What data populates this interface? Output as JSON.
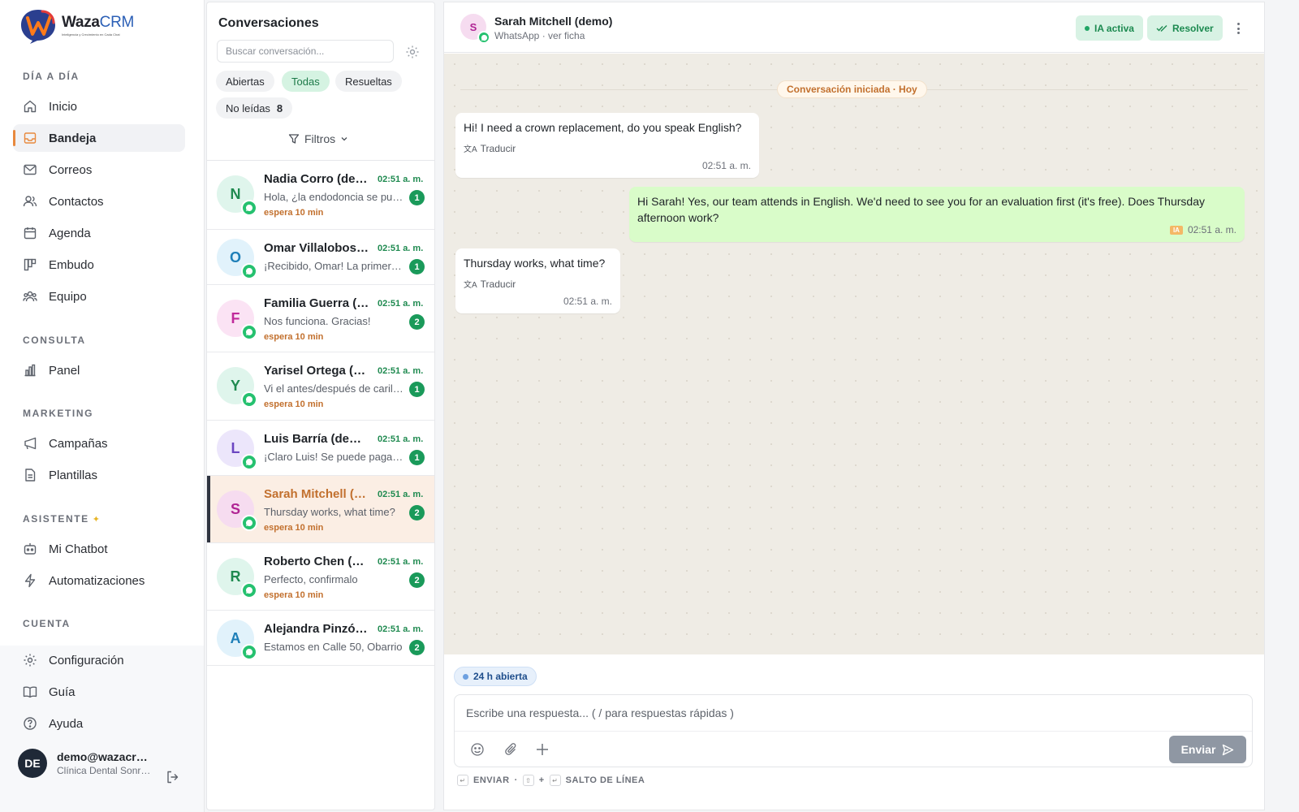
{
  "brand": {
    "name_a": "Waza",
    "name_b": "CRM",
    "tagline": "Inteligencia y Crecimiento en Cada Chat"
  },
  "sidebar": {
    "sections": [
      {
        "title": "DÍA A DÍA"
      },
      {
        "title": "CONSULTA"
      },
      {
        "title": "MARKETING"
      },
      {
        "title": "ASISTENTE"
      },
      {
        "title": "CUENTA"
      }
    ],
    "items": [
      {
        "label": "Inicio",
        "icon": "home-icon"
      },
      {
        "label": "Bandeja",
        "icon": "inbox-icon",
        "active": true
      },
      {
        "label": "Correos",
        "icon": "mail-icon"
      },
      {
        "label": "Contactos",
        "icon": "contacts-icon"
      },
      {
        "label": "Agenda",
        "icon": "calendar-icon"
      },
      {
        "label": "Embudo",
        "icon": "funnel-icon"
      },
      {
        "label": "Equipo",
        "icon": "team-icon"
      },
      {
        "label": "Panel",
        "icon": "chart-icon"
      },
      {
        "label": "Campañas",
        "icon": "campaign-icon"
      },
      {
        "label": "Plantillas",
        "icon": "template-icon"
      },
      {
        "label": "Mi Chatbot",
        "icon": "bot-icon"
      },
      {
        "label": "Automatizaciones",
        "icon": "bolt-icon"
      },
      {
        "label": "Configuración",
        "icon": "settings-icon"
      },
      {
        "label": "Guía",
        "icon": "book-icon"
      },
      {
        "label": "Ayuda",
        "icon": "help-icon"
      }
    ],
    "user": {
      "initials": "DE",
      "email": "demo@wazacrm.com",
      "org": "Clínica Dental Sonrisa"
    }
  },
  "conversations": {
    "title": "Conversaciones",
    "search_placeholder": "Buscar conversación...",
    "filters": {
      "open": "Abiertas",
      "all": "Todas",
      "resolved": "Resueltas",
      "unread": "No leídas",
      "unread_count": "8",
      "filters_label": "Filtros"
    },
    "items": [
      {
        "initial": "N",
        "name": "Nadia Corro (demo)",
        "time": "02:51 a. m.",
        "preview": "Hola, ¿la endodoncia se puede hacer en una cita?",
        "badge": "1",
        "wait": "espera 10 min",
        "bg": "#dff5ec",
        "fg": "#1f8a50"
      },
      {
        "initial": "O",
        "name": "Omar Villalobos (demo)",
        "time": "02:51 a. m.",
        "preview": "¡Recibido, Omar! La primera consulta es gratis",
        "badge": "1",
        "wait": "",
        "bg": "#e1f2fb",
        "fg": "#1e7fb8"
      },
      {
        "initial": "F",
        "name": "Familia Guerra (demo)",
        "time": "02:51 a. m.",
        "preview": "Nos funciona. Gracias!",
        "badge": "2",
        "wait": "espera 10 min",
        "bg": "#fbe3f4",
        "fg": "#c02a9b"
      },
      {
        "initial": "Y",
        "name": "Yarisel Ortega (demo)",
        "time": "02:51 a. m.",
        "preview": "Vi el antes/después de carillas en Instagram",
        "badge": "1",
        "wait": "espera 10 min",
        "bg": "#dff5ec",
        "fg": "#1f8a50"
      },
      {
        "initial": "L",
        "name": "Luis Barría (demo)",
        "time": "02:51 a. m.",
        "preview": "¡Claro Luis! Se puede pagar en cuotas",
        "badge": "1",
        "wait": "",
        "bg": "#ece6fb",
        "fg": "#6b46c1"
      },
      {
        "initial": "S",
        "name": "Sarah Mitchell (demo)",
        "time": "02:51 a. m.",
        "preview": "Thursday works, what time?",
        "badge": "2",
        "wait": "espera 10 min",
        "bg": "#f6dcf0",
        "fg": "#b02494",
        "active": true
      },
      {
        "initial": "R",
        "name": "Roberto Chen (demo)",
        "time": "02:51 a. m.",
        "preview": "Perfecto, confirmalo",
        "badge": "2",
        "wait": "espera 10 min",
        "bg": "#dff5ec",
        "fg": "#1f8a50"
      },
      {
        "initial": "A",
        "name": "Alejandra Pinzón (demo)",
        "time": "02:51 a. m.",
        "preview": "Estamos en Calle 50, Obarrio",
        "badge": "2",
        "wait": "",
        "bg": "#e1f2fb",
        "fg": "#1e7fb8"
      }
    ]
  },
  "chat": {
    "header": {
      "initial": "S",
      "name": "Sarah Mitchell (demo)",
      "sub": "WhatsApp · ver ficha",
      "ia_label": "IA activa",
      "resolve_label": "Resolver"
    },
    "day_chip": "Conversación iniciada · Hoy",
    "messages": [
      {
        "text": "Hi! I need a crown replacement, do you speak English?",
        "translate": "Traducir",
        "time": "02:51 a. m."
      },
      {
        "text": "Hi Sarah! Yes, our team attends in English. We'd need to see you for an evaluation first (it's free). Does Thursday afternoon work?",
        "ia_tag": "IA",
        "time": "02:51 a. m."
      },
      {
        "text": "Thursday works, what time?",
        "translate": "Traducir",
        "time": "02:51 a. m."
      }
    ],
    "window_chip": "24 h abierta",
    "composer_placeholder": "Escribe una respuesta... ( / para respuestas rápidas )",
    "send_label": "Enviar",
    "hints": {
      "send": "ENVIAR",
      "sep": "·",
      "plus": "+",
      "newline": "SALTO DE LÍNEA"
    }
  }
}
